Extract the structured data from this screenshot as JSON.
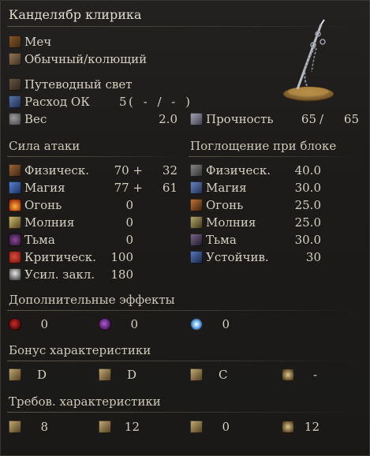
{
  "weapon": {
    "name": "Канделябр клирика",
    "type": "Меч",
    "attack_type": "Обычный/колющий"
  },
  "skill": {
    "name": "Путеводный свет"
  },
  "fp_cost": {
    "label": "Расход ОК",
    "value": "5",
    "paren": "( - / - )"
  },
  "weight": {
    "label": "Вес",
    "value": "2.0"
  },
  "durability": {
    "label": "Прочность",
    "current": "65",
    "sep": "/",
    "max": "65"
  },
  "attack": {
    "heading": "Сила атаки",
    "rows": [
      {
        "label": "Физическ.",
        "value": "70 +",
        "bonus": "32",
        "icon": "physical-attack-icon"
      },
      {
        "label": "Магия",
        "value": "77 +",
        "bonus": "61",
        "icon": "magic-attack-icon"
      },
      {
        "label": "Огонь",
        "value": "0",
        "bonus": "",
        "icon": "fire-attack-icon"
      },
      {
        "label": "Молния",
        "value": "0",
        "bonus": "",
        "icon": "lightning-attack-icon"
      },
      {
        "label": "Тьма",
        "value": "0",
        "bonus": "",
        "icon": "dark-attack-icon"
      },
      {
        "label": "Критическ.",
        "value": "100",
        "bonus": "",
        "icon": "critical-icon"
      },
      {
        "label": "Усил. закл.",
        "value": "180",
        "bonus": "",
        "icon": "spell-buff-icon"
      }
    ]
  },
  "guard": {
    "heading": "Поглощение при блоке",
    "rows": [
      {
        "label": "Физическ.",
        "value": "40.0",
        "icon": "physical-guard-icon"
      },
      {
        "label": "Магия",
        "value": "30.0",
        "icon": "magic-guard-icon"
      },
      {
        "label": "Огонь",
        "value": "25.0",
        "icon": "fire-guard-icon"
      },
      {
        "label": "Молния",
        "value": "25.0",
        "icon": "lightning-guard-icon"
      },
      {
        "label": "Тьма",
        "value": "30.0",
        "icon": "dark-guard-icon"
      },
      {
        "label": "Устойчив.",
        "value": "30",
        "icon": "stability-icon"
      }
    ]
  },
  "effects": {
    "heading": "Дополнительные эффекты",
    "items": [
      {
        "value": "0",
        "icon": "bleed-icon"
      },
      {
        "value": "0",
        "icon": "poison-icon"
      },
      {
        "value": "0",
        "icon": "frost-icon"
      }
    ]
  },
  "bonus": {
    "heading": "Бонус характеристики",
    "items": [
      {
        "value": "D",
        "icon": "strength-icon"
      },
      {
        "value": "D",
        "icon": "dexterity-icon"
      },
      {
        "value": "C",
        "icon": "intelligence-icon"
      },
      {
        "value": "-",
        "icon": "faith-icon"
      }
    ]
  },
  "requirements": {
    "heading": "Требов. характеристики",
    "items": [
      {
        "value": "8",
        "icon": "strength-icon"
      },
      {
        "value": "12",
        "icon": "dexterity-icon"
      },
      {
        "value": "0",
        "icon": "intelligence-icon"
      },
      {
        "value": "12",
        "icon": "faith-icon"
      }
    ]
  },
  "colors": {
    "text": "#d6d0c4",
    "heading": "#cfc8ba",
    "background": "#1b1a18",
    "rule": "#5a544b"
  }
}
